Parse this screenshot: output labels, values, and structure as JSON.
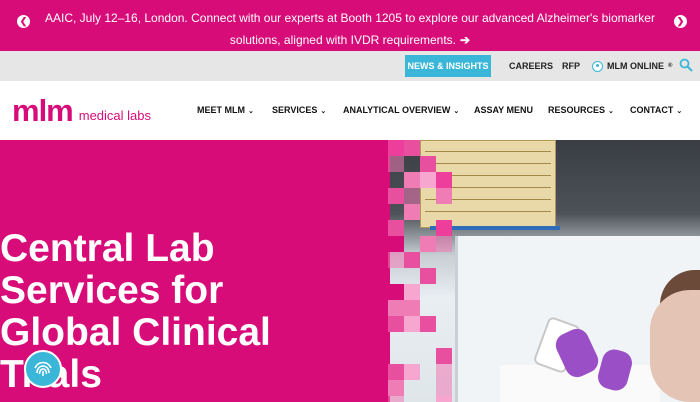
{
  "announcement": {
    "text": "AAIC, July 12–16, London. Connect with our experts at Booth 1205 to explore our advanced Alzheimer's biomarker solutions, aligned with IVDR requirements.",
    "arrow": "➔",
    "prev_icon": "chevron-left-icon",
    "next_icon": "chevron-right-icon",
    "prev_glyph": "❮",
    "next_glyph": "❯"
  },
  "utility": {
    "news_label": "NEWS & INSIGHTS",
    "careers_label": "CAREERS",
    "rfp_label": "RFP",
    "online_label": "MLM ONLINE",
    "online_mark": "®"
  },
  "logo": {
    "mark": "mlm",
    "tagline": "medical labs"
  },
  "nav": {
    "items": [
      {
        "label": "MEET MLM",
        "chevron": "⌄"
      },
      {
        "label": "SERVICES",
        "chevron": "⌄"
      },
      {
        "label": "ANALYTICAL OVERVIEW",
        "chevron": "⌄"
      },
      {
        "label": "ASSAY MENU",
        "chevron": ""
      },
      {
        "label": "RESOURCES",
        "chevron": "⌄"
      },
      {
        "label": "CONTACT",
        "chevron": "⌄"
      }
    ]
  },
  "hero": {
    "title": "Central Lab\nServices for\nGlobal Clinical\nTrials"
  },
  "colors": {
    "brand_magenta": "#d80c78",
    "accent_blue": "#3ab7d8"
  }
}
